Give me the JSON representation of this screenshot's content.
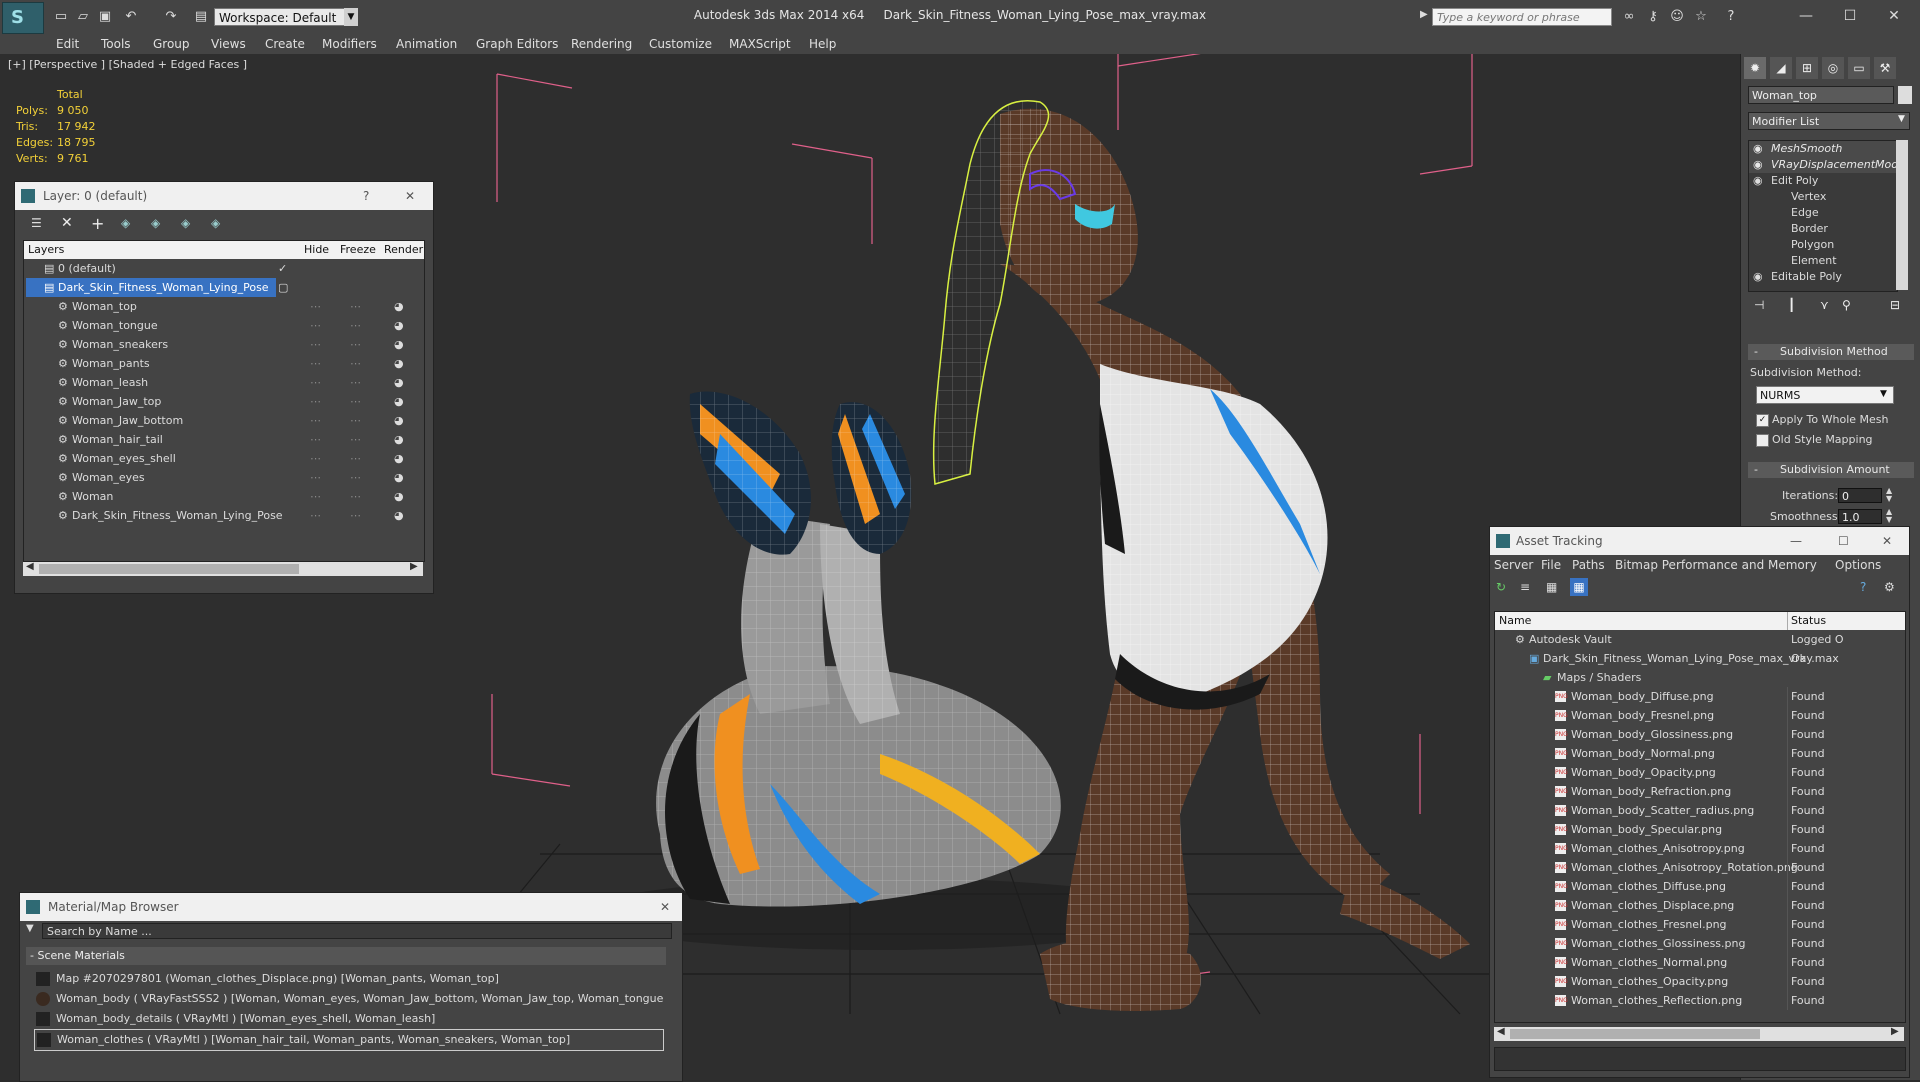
{
  "titlebar": {
    "workspace_label": "Workspace: Default",
    "app_name": "Autodesk 3ds Max  2014 x64",
    "file_name": "Dark_Skin_Fitness_Woman_Lying_Pose_max_vray.max",
    "search_placeholder": "Type a keyword or phrase"
  },
  "menu": [
    "Edit",
    "Tools",
    "Group",
    "Views",
    "Create",
    "Modifiers",
    "Animation",
    "Graph Editors",
    "Rendering",
    "Customize",
    "MAXScript",
    "Help"
  ],
  "viewport": {
    "label": "[+] [Perspective ] [Shaded + Edged Faces ]",
    "stats_header": "Total",
    "stats": [
      {
        "label": "Polys:",
        "value": "9 050"
      },
      {
        "label": "Tris:",
        "value": "17 942"
      },
      {
        "label": "Edges:",
        "value": "18 795"
      },
      {
        "label": "Verts:",
        "value": "9 761"
      }
    ]
  },
  "layer_panel": {
    "title": "Layer: 0 (default)",
    "help": "?",
    "close": "✕",
    "columns": [
      "Layers",
      "Hide",
      "Freeze",
      "Render"
    ],
    "default_layer": "0 (default)",
    "selected_layer": "Dark_Skin_Fitness_Woman_Lying_Pose",
    "objects": [
      "Woman_top",
      "Woman_tongue",
      "Woman_sneakers",
      "Woman_pants",
      "Woman_leash",
      "Woman_Jaw_top",
      "Woman_Jaw_bottom",
      "Woman_hair_tail",
      "Woman_eyes_shell",
      "Woman_eyes",
      "Woman",
      "Dark_Skin_Fitness_Woman_Lying_Pose"
    ]
  },
  "material_browser": {
    "title": "Material/Map Browser",
    "close": "✕",
    "search_placeholder": "Search by Name ...",
    "section": "- Scene Materials",
    "items": [
      "Map #2070297801 (Woman_clothes_Displace.png)  [Woman_pants, Woman_top]",
      "Woman_body  ( VRayFastSSS2 )  [Woman, Woman_eyes, Woman_Jaw_bottom, Woman_Jaw_top, Woman_tongue]",
      "Woman_body_details  ( VRayMtl )  [Woman_eyes_shell, Woman_leash]",
      "Woman_clothes  ( VRayMtl )  [Woman_hair_tail, Woman_pants, Woman_sneakers, Woman_top]"
    ]
  },
  "command_panel": {
    "object_name": "Woman_top",
    "modifier_list": "Modifier List",
    "stack": [
      {
        "label": "MeshSmooth",
        "italic": true,
        "indent": 0
      },
      {
        "label": "VRayDisplacementMod",
        "italic": true,
        "indent": 0
      },
      {
        "label": "Edit Poly",
        "italic": false,
        "indent": 0
      },
      {
        "label": "Vertex",
        "italic": false,
        "indent": 1
      },
      {
        "label": "Edge",
        "italic": false,
        "indent": 1
      },
      {
        "label": "Border",
        "italic": false,
        "indent": 1
      },
      {
        "label": "Polygon",
        "italic": false,
        "indent": 1
      },
      {
        "label": "Element",
        "italic": false,
        "indent": 1
      },
      {
        "label": "Editable Poly",
        "italic": false,
        "indent": 0
      }
    ],
    "subdivision_method_rollout": "Subdivision Method",
    "subdivision_method_label": "Subdivision Method:",
    "subdivision_method_value": "NURMS",
    "apply_whole_mesh": "Apply To Whole Mesh",
    "old_style_mapping": "Old Style Mapping",
    "subdivision_amount_rollout": "Subdivision Amount",
    "iterations_label": "Iterations:",
    "iterations_value": "0",
    "smoothness_label": "Smoothness:",
    "smoothness_value": "1.0"
  },
  "asset_tracking": {
    "title": "Asset Tracking",
    "menu": [
      "Server",
      "File",
      "Paths",
      "Bitmap Performance and Memory",
      "Options"
    ],
    "col_name": "Name",
    "col_status": "Status",
    "vault": "Autodesk Vault",
    "vault_status": "Logged O",
    "file": "Dark_Skin_Fitness_Woman_Lying_Pose_max_vray.max",
    "file_status": "Ok",
    "maps_folder": "Maps / Shaders",
    "maps": [
      "Woman_body_Diffuse.png",
      "Woman_body_Fresnel.png",
      "Woman_body_Glossiness.png",
      "Woman_body_Normal.png",
      "Woman_body_Opacity.png",
      "Woman_body_Refraction.png",
      "Woman_body_Scatter_radius.png",
      "Woman_body_Specular.png",
      "Woman_clothes_Anisotropy.png",
      "Woman_clothes_Anisotropy_Rotation.png",
      "Woman_clothes_Diffuse.png",
      "Woman_clothes_Displace.png",
      "Woman_clothes_Fresnel.png",
      "Woman_clothes_Glossiness.png",
      "Woman_clothes_Normal.png",
      "Woman_clothes_Opacity.png",
      "Woman_clothes_Reflection.png"
    ],
    "found_status": "Found",
    "png_badge": "PNG"
  },
  "colors": {
    "selection": "#3872c2",
    "stats": "#f2d038",
    "bbox": "#e0608a",
    "skin": "#5a3a28",
    "top": "#e4e4e4",
    "accent_blue": "#2a8ae0",
    "accent_orange": "#f09020",
    "accent_yellow": "#f0b020",
    "hair_wire": "#d8f040"
  }
}
